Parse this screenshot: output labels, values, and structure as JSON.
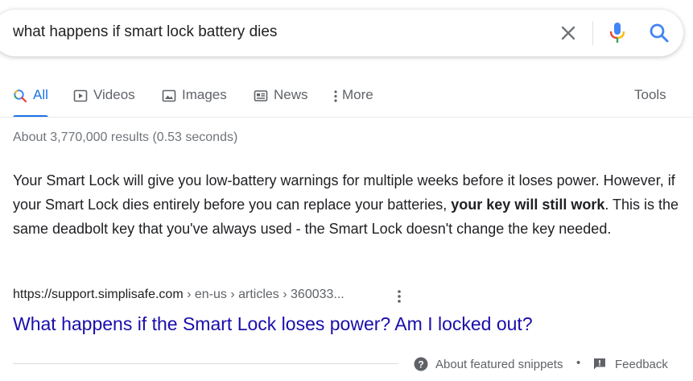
{
  "search": {
    "query": "what happens if smart lock battery dies",
    "icons": [
      "close-icon",
      "microphone-icon",
      "search-icon"
    ]
  },
  "tabs": [
    {
      "label": "All",
      "icon": "search-icon",
      "active": true
    },
    {
      "label": "Videos",
      "icon": "video-icon",
      "active": false
    },
    {
      "label": "Images",
      "icon": "image-icon",
      "active": false
    },
    {
      "label": "News",
      "icon": "news-icon",
      "active": false
    },
    {
      "label": "More",
      "icon": "more-vertical-icon",
      "active": false
    }
  ],
  "tools_label": "Tools",
  "stats": "About 3,770,000 results (0.53 seconds)",
  "snippet": {
    "text_before": "Your Smart Lock will give you low-battery warnings for multiple weeks before it loses power. However, if your Smart Lock dies entirely before you can replace your batteries, ",
    "bold": "your key will still work",
    "text_after": ". This is the same deadbolt key that you've always used - the Smart Lock doesn't change the key needed."
  },
  "result": {
    "cite_domain": "https://support.simplisafe.com",
    "cite_sep1": " › ",
    "cite_path1": "en-us",
    "cite_sep2": " › ",
    "cite_path2": "articles",
    "cite_sep3": " › ",
    "cite_path3": "360033...",
    "title": "What happens if the Smart Lock loses power? Am I locked out?"
  },
  "footer": {
    "about_label": "About featured snippets",
    "separator": "•",
    "feedback_label": "Feedback"
  },
  "colors": {
    "accent": "#1a73e8",
    "link": "#1a0dab",
    "muted": "#5f6368",
    "mic_blue": "#4285f4",
    "mic_red": "#ea4335",
    "mic_yellow": "#fbbc04",
    "mic_green": "#34a853"
  }
}
